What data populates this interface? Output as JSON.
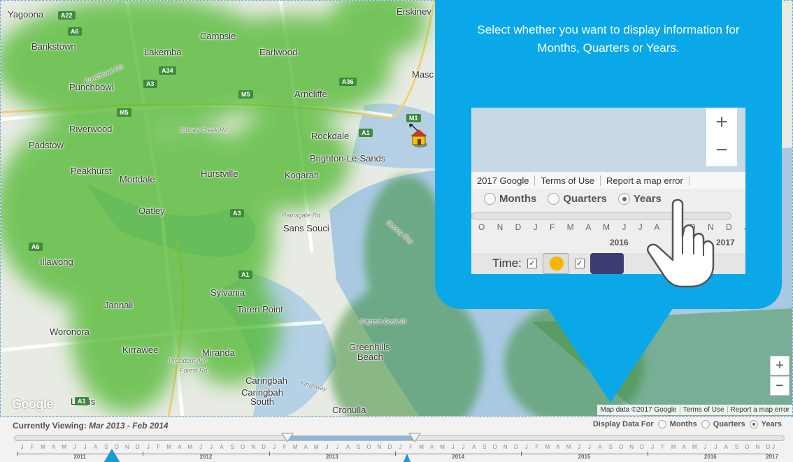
{
  "map": {
    "places": [
      {
        "id": "yagoona",
        "label": "Yagoona"
      },
      {
        "id": "campsie",
        "label": "Campsie"
      },
      {
        "id": "bankstown",
        "label": "Bankstown"
      },
      {
        "id": "lakemba",
        "label": "Lakemba"
      },
      {
        "id": "earlwood",
        "label": "Earlwood"
      },
      {
        "id": "erskineville",
        "label": "Erskinev"
      },
      {
        "id": "punchbowl",
        "label": "Punchbowl"
      },
      {
        "id": "arncliffe",
        "label": "Arncliffe"
      },
      {
        "id": "riverwood",
        "label": "Riverwood"
      },
      {
        "id": "padstow",
        "label": "Padstow"
      },
      {
        "id": "rockdale",
        "label": "Rockdale"
      },
      {
        "id": "brighton",
        "label": "Brighton-Le-Sands"
      },
      {
        "id": "peakhurst",
        "label": "Peakhurst"
      },
      {
        "id": "mortdale",
        "label": "Mortdale"
      },
      {
        "id": "hurstville",
        "label": "Hurstville"
      },
      {
        "id": "kogarah",
        "label": "Kogarah"
      },
      {
        "id": "oatley",
        "label": "Oatley"
      },
      {
        "id": "sans-souci",
        "label": "Sans Souci"
      },
      {
        "id": "illawong",
        "label": "Illawong"
      },
      {
        "id": "sylvania",
        "label": "Sylvania"
      },
      {
        "id": "jannali",
        "label": "Jannali"
      },
      {
        "id": "taren-point",
        "label": "Taren Point"
      },
      {
        "id": "woronora",
        "label": "Woronora"
      },
      {
        "id": "kirrawee",
        "label": "Kirrawee"
      },
      {
        "id": "miranda",
        "label": "Miranda"
      },
      {
        "id": "greenhills",
        "label": "Greenhills"
      },
      {
        "id": "beach",
        "label": "Beach"
      },
      {
        "id": "caringbah",
        "label": "Caringbah"
      },
      {
        "id": "caringbah-south",
        "label": "Caringbah\nSouth"
      },
      {
        "id": "loftus",
        "label": "Loftus"
      },
      {
        "id": "cronulla",
        "label": "Cronulla"
      },
      {
        "id": "mascot",
        "label": "Masc"
      }
    ],
    "road_labels": [
      {
        "id": "punchbowl-rd",
        "label": "Punchbowl Rd"
      },
      {
        "id": "stoney-creek-rd",
        "label": "Stoney Creek Rd"
      },
      {
        "id": "forest-rd",
        "label": "Forest Rd"
      },
      {
        "id": "president-ave",
        "label": "President Ave"
      },
      {
        "id": "kingsway",
        "label": "Kingsway"
      },
      {
        "id": "captain-cook-dr",
        "label": "Captain Cook Dr"
      },
      {
        "id": "ramsgate-rd",
        "label": "Ramsgate Rd"
      },
      {
        "id": "botany-bay",
        "label": "Botany Bay"
      }
    ],
    "shields": [
      "A22",
      "A6",
      "A34",
      "A3",
      "M5",
      "A36",
      "M5",
      "M1",
      "A1",
      "A3",
      "A6",
      "A1",
      "A1"
    ],
    "footer": {
      "data": "Map data ©2017 Google",
      "terms": "Terms of Use",
      "report": "Report a map error"
    },
    "logo": "Google",
    "zoom_in": "+",
    "zoom_out": "−"
  },
  "callout": {
    "text": "Select whether you want to display information for Months, Quarters or Years.",
    "zoom": {
      "zoom_in": "+",
      "zoom_out": "−",
      "footer": [
        "2017 Google",
        "Terms of Use",
        "Report a map error"
      ],
      "options": [
        "Months",
        "Quarters",
        "Years"
      ],
      "selected": "Years",
      "months": "O N D J F M A M J J A S O N D J",
      "year": "2016",
      "year_next": "2017",
      "time_label": "Time:"
    }
  },
  "controls": {
    "viewing_label": "Currently Viewing:",
    "viewing_value": "Mar 2013 - Feb 2014",
    "display_for_label": "Display Data For",
    "options": [
      {
        "label": "Months",
        "checked": false
      },
      {
        "label": "Quarters",
        "checked": false
      },
      {
        "label": "Years",
        "checked": true
      }
    ],
    "timeline": {
      "months": [
        "J",
        "F",
        "M",
        "A",
        "M",
        "J",
        "J",
        "A",
        "S",
        "O",
        "N",
        "D"
      ],
      "years": [
        "2011",
        "2012",
        "2013",
        "2014",
        "2015",
        "2016",
        "2017"
      ],
      "range_start": "Mar 2013",
      "range_end": "Feb 2014"
    }
  },
  "colors": {
    "callout": "#0aa8e8",
    "heat": "#4fb82d",
    "water": "#a9c9e2"
  }
}
